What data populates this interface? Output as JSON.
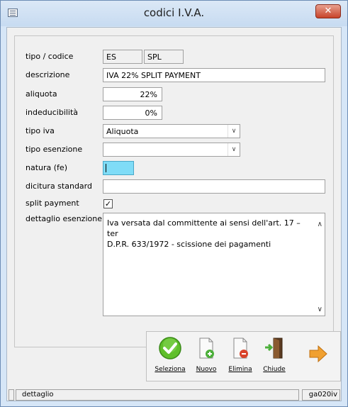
{
  "window": {
    "title": "codici I.V.A.",
    "close_label": "✕"
  },
  "form": {
    "tipo_codice": {
      "label": "tipo / codice",
      "tipo": "ES",
      "codice": "SPL"
    },
    "descrizione": {
      "label": "descrizione",
      "value": "IVA 22% SPLIT PAYMENT"
    },
    "aliquota": {
      "label": "aliquota",
      "value": "22%"
    },
    "indeducibilita": {
      "label": "indeducibilità",
      "value": "0%"
    },
    "tipo_iva": {
      "label": "tipo iva",
      "value": "Aliquota"
    },
    "tipo_esenzione": {
      "label": "tipo esenzione",
      "value": ""
    },
    "natura_fe": {
      "label": "natura (fe)",
      "value": ""
    },
    "dicitura_standard": {
      "label": "dicitura standard",
      "value": ""
    },
    "split_payment": {
      "label": "split payment",
      "checked": true,
      "mark": "✓"
    },
    "dettaglio_esenzione": {
      "label": "dettaglio esenzione",
      "line1": "Iva versata dal committente ai sensi dell'art. 17 –ter",
      "line2": "D.P.R. 633/1972 - scissione dei pagamenti"
    }
  },
  "toolbar": {
    "seleziona": "Seleziona",
    "nuovo": "Nuovo",
    "elimina": "Elimina",
    "chiude": "Chiude"
  },
  "statusbar": {
    "left": "dettaglio",
    "right": "ga020iv"
  },
  "colors": {
    "focus_field": "#7fdcf7",
    "close_button": "#c7432a",
    "confirm_icon": "#5fbf2a",
    "next_arrow": "#f0a030"
  }
}
